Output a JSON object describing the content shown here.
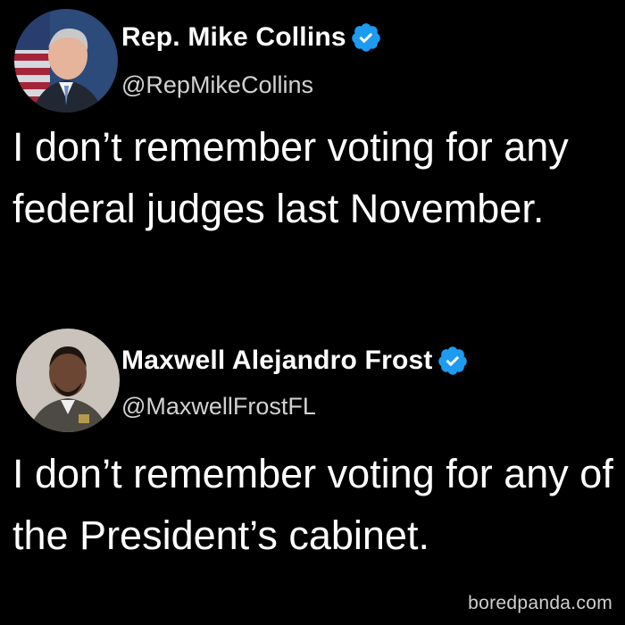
{
  "colors": {
    "background": "#000000",
    "text": "#ffffff",
    "handle": "#d2d2d2",
    "verified": "#1d9bf0"
  },
  "tweets": [
    {
      "display_name": "Rep. Mike Collins",
      "handle": "@RepMikeCollins",
      "verified_icon": "verified-badge-icon",
      "text": "I don’t remember voting for any federal judges last November."
    },
    {
      "display_name": "Maxwell Alejandro Frost",
      "handle": "@MaxwellFrostFL",
      "verified_icon": "verified-badge-icon",
      "text": "I don’t remember voting for any of the President’s cabinet."
    }
  ],
  "watermark": "boredpanda.com"
}
